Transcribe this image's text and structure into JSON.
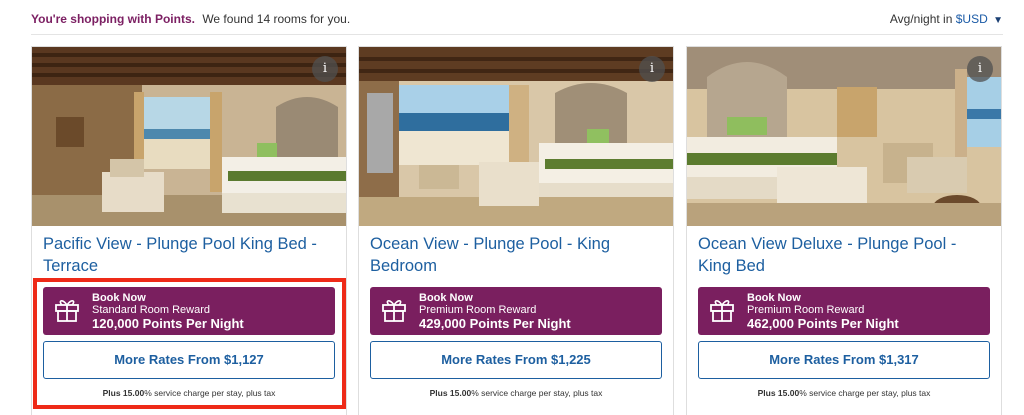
{
  "header": {
    "points_text": "You're shopping with Points.",
    "found_text": "We found 14 rooms for you.",
    "avg_label": "Avg/night in",
    "currency": "$USD",
    "currency_caret": "▼"
  },
  "colors": {
    "brand_purple": "#7a1f5f",
    "link_blue": "#1d5fa0",
    "highlight_red": "#ee2a18"
  },
  "cards": [
    {
      "title": "Pacific View - Plunge Pool King Bed - Terrace",
      "info_icon": "i",
      "reward": {
        "line1": "Book Now",
        "line2": "Standard Room Reward",
        "line3": "120,000 Points Per Night"
      },
      "rates_label": "More Rates From $1,127",
      "note_bold": "Plus 15.00",
      "note_rest": "% service charge per stay, plus tax"
    },
    {
      "title": "Ocean View - Plunge Pool - King Bedroom",
      "info_icon": "i",
      "reward": {
        "line1": "Book Now",
        "line2": "Premium Room Reward",
        "line3": "429,000 Points Per Night"
      },
      "rates_label": "More Rates From $1,225",
      "note_bold": "Plus 15.00",
      "note_rest": "% service charge per stay, plus tax"
    },
    {
      "title": "Ocean View Deluxe - Plunge Pool - King Bed",
      "info_icon": "i",
      "reward": {
        "line1": "Book Now",
        "line2": "Premium Room Reward",
        "line3": "462,000 Points Per Night"
      },
      "rates_label": "More Rates From $1,317",
      "note_bold": "Plus 15.00",
      "note_rest": "% service charge per stay, plus tax"
    }
  ]
}
